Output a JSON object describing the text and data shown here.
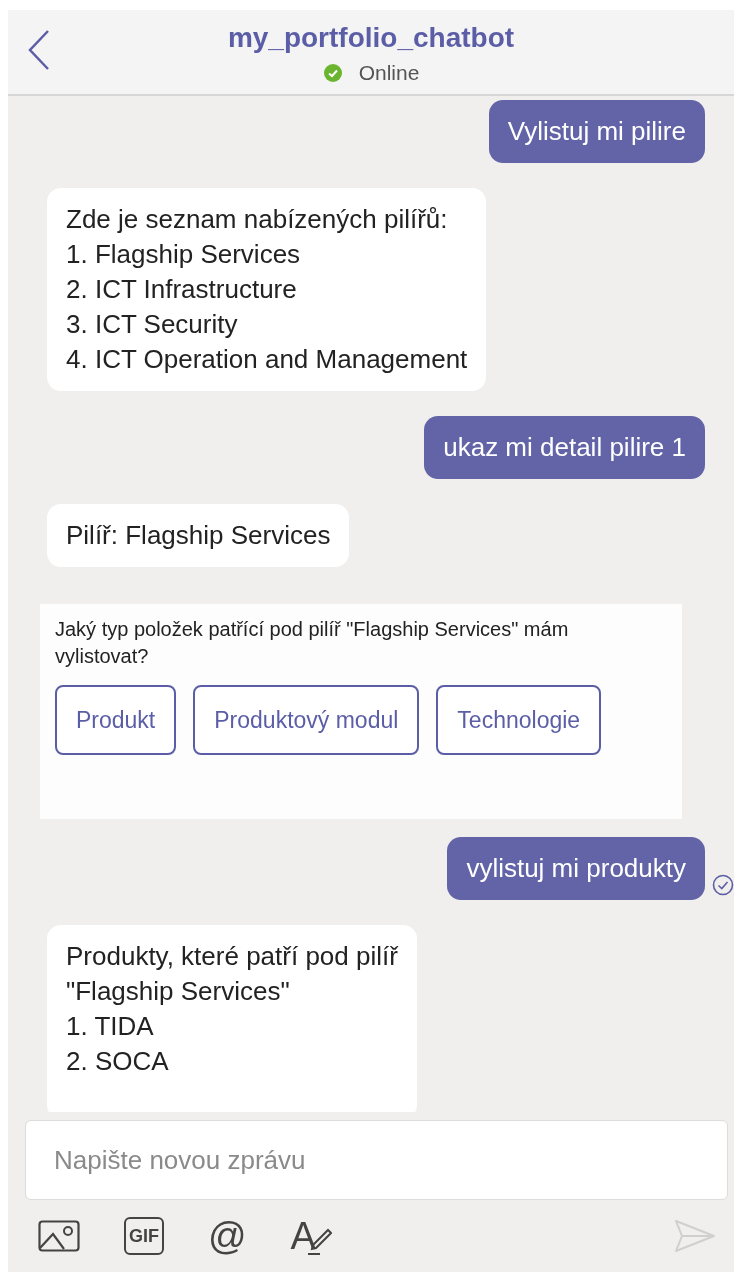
{
  "header": {
    "title": "my_portfolio_chatbot",
    "status": "Online",
    "online": true
  },
  "messages": [
    {
      "kind": "user",
      "text": "Vylistuj mi pilire",
      "delivered": false
    },
    {
      "kind": "bot",
      "lines": [
        "Zde je seznam nabízených pilířů:",
        "1. Flagship Services",
        "2. ICT Infrastructure",
        "3. ICT Security",
        "4. ICT Operation and Management"
      ]
    },
    {
      "kind": "user",
      "text": "ukaz mi detail pilire 1",
      "delivered": false
    },
    {
      "kind": "bot",
      "lines": [
        "Pilíř: Flagship Services"
      ]
    },
    {
      "kind": "card",
      "text": "Jaký typ položek patřící pod pilíř \"Flagship Services\" mám vylistovat?",
      "buttons": [
        "Produkt",
        "Produktový modul",
        "Technologie"
      ]
    },
    {
      "kind": "user",
      "text": "vylistuj mi produkty",
      "delivered": true
    },
    {
      "kind": "bot",
      "lines": [
        "Produkty, které patří pod pilíř",
        "\"Flagship Services\"",
        "1. TIDA",
        "2. SOCA"
      ],
      "cut": true
    }
  ],
  "compose": {
    "placeholder": "Napište novou zprávu"
  },
  "toolbar": [
    {
      "kind": "image"
    },
    {
      "kind": "gif",
      "label": "GIF"
    },
    {
      "kind": "mention",
      "label": "@"
    },
    {
      "kind": "format",
      "label": "A"
    },
    {
      "kind": "send",
      "disabled": true
    }
  ]
}
